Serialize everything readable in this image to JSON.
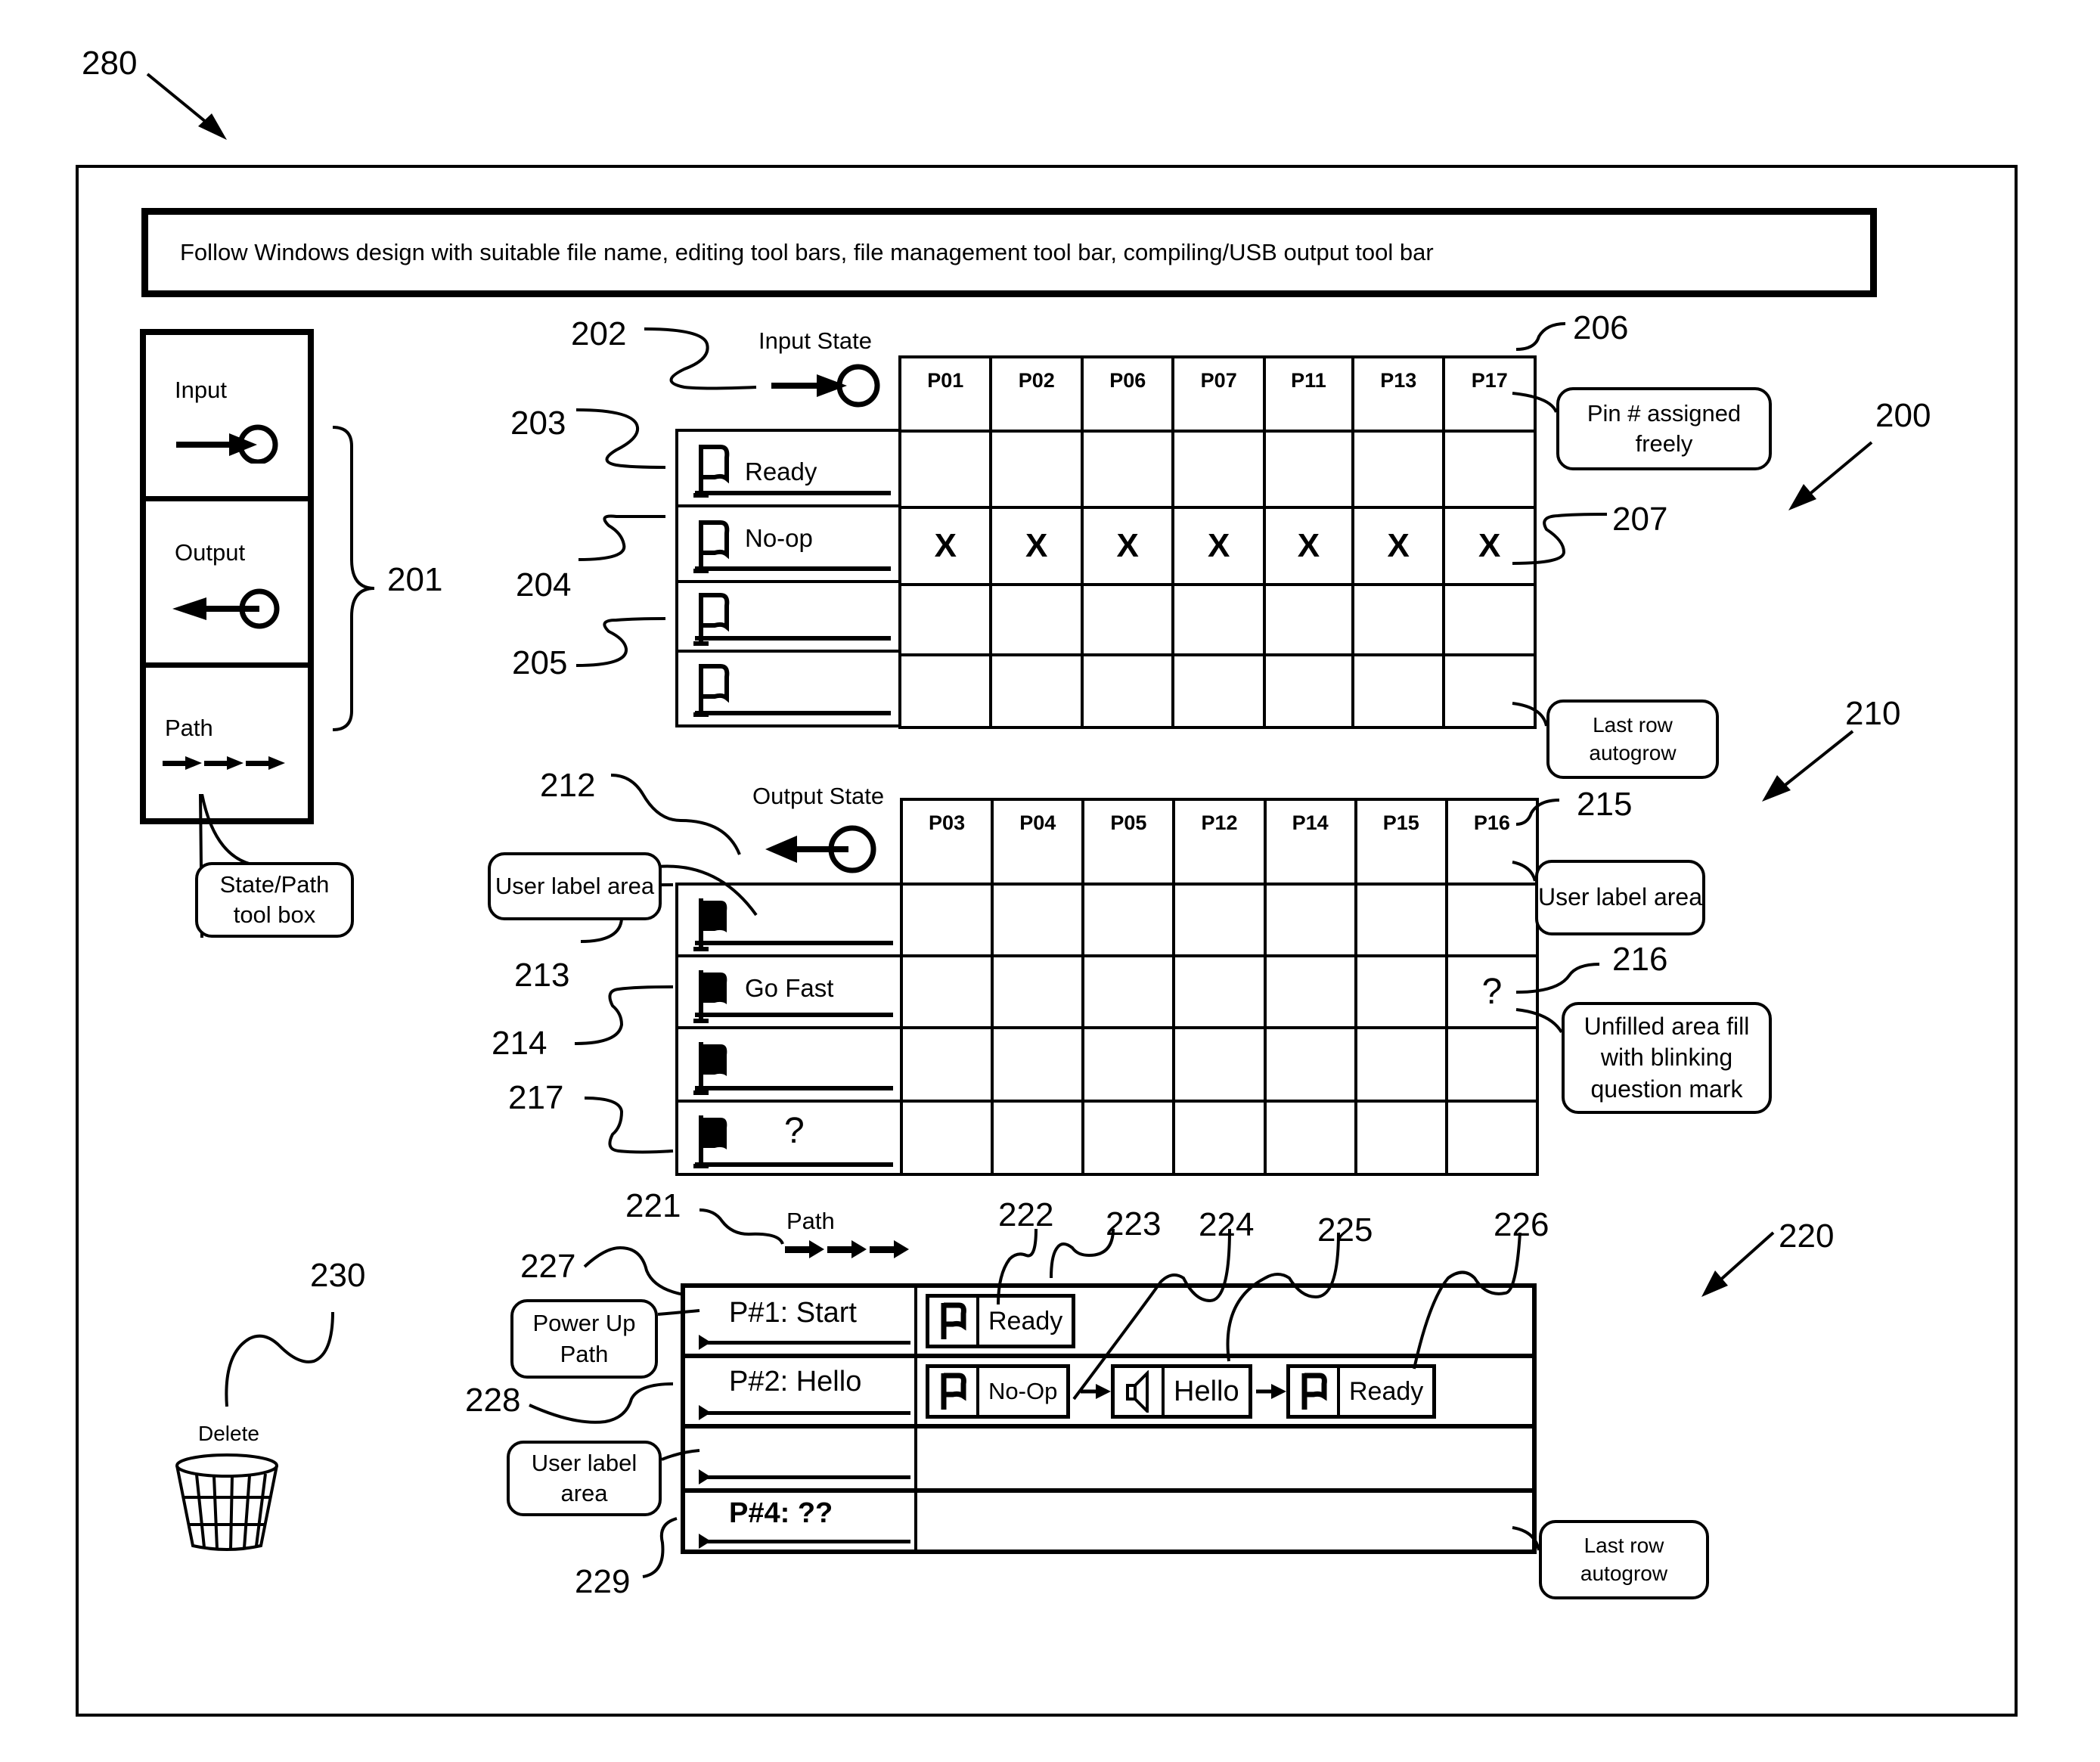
{
  "figure_refs": {
    "r280": "280",
    "r200": "200",
    "r201": "201",
    "r202": "202",
    "r203": "203",
    "r204": "204",
    "r205": "205",
    "r206": "206",
    "r207": "207",
    "r210": "210",
    "r212": "212",
    "r213": "213",
    "r214": "214",
    "r215": "215",
    "r216": "216",
    "r217": "217",
    "r220": "220",
    "r221": "221",
    "r222": "222",
    "r223": "223",
    "r224": "224",
    "r225": "225",
    "r226": "226",
    "r227": "227",
    "r228": "228",
    "r229": "229",
    "r230": "230"
  },
  "header_bar": {
    "text": "Follow Windows design with suitable file name, editing tool bars, file management tool bar, compiling/USB output tool bar"
  },
  "toolbox": {
    "items": [
      {
        "label": "Input",
        "icon": "input-arrow-circle-icon"
      },
      {
        "label": "Output",
        "icon": "output-arrow-circle-icon"
      },
      {
        "label": "Path",
        "icon": "path-arrows-icon"
      }
    ],
    "callout": "State/Path tool box"
  },
  "input_state": {
    "title": "Input State",
    "pins": [
      "P01",
      "P02",
      "P06",
      "P07",
      "P11",
      "P13",
      "P17"
    ],
    "rows": [
      {
        "label": "Ready",
        "cells": [
          "",
          "",
          "",
          "",
          "",
          "",
          ""
        ]
      },
      {
        "label": "No-op",
        "cells": [
          "X",
          "X",
          "X",
          "X",
          "X",
          "X",
          "X"
        ]
      },
      {
        "label": "",
        "cells": [
          "",
          "",
          "",
          "",
          "",
          "",
          ""
        ]
      },
      {
        "label": "",
        "cells": [
          "",
          "",
          "",
          "",
          "",
          "",
          ""
        ]
      }
    ],
    "callouts": {
      "pin_assigned": "Pin # assigned freely",
      "last_row": "Last row autogrow"
    }
  },
  "output_state": {
    "title": "Output State",
    "pins": [
      "P03",
      "P04",
      "P05",
      "P12",
      "P14",
      "P15",
      "P16"
    ],
    "rows": [
      {
        "label": "",
        "cells": [
          "",
          "",
          "",
          "",
          "",
          "",
          ""
        ]
      },
      {
        "label": "Go Fast",
        "cells": [
          "",
          "",
          "",
          "",
          "",
          "",
          "?"
        ]
      },
      {
        "label": "",
        "cells": [
          "",
          "",
          "",
          "",
          "",
          "",
          ""
        ]
      },
      {
        "label": "?",
        "cells": [
          "",
          "",
          "",
          "",
          "",
          "",
          ""
        ]
      }
    ],
    "callouts": {
      "user_label_left": "User label area",
      "user_label_right": "User label area",
      "unfilled": "Unfilled area fill with blinking question mark"
    }
  },
  "paths": {
    "title": "Path",
    "rows": [
      {
        "name": "P#1: Start",
        "bold": false,
        "steps": [
          {
            "icon": "flag-icon",
            "label": "Ready"
          }
        ]
      },
      {
        "name": "P#2: Hello",
        "bold": false,
        "steps": [
          {
            "icon": "flag-icon",
            "label": "No-Op"
          },
          {
            "icon": "speaker-icon",
            "label": "Hello"
          },
          {
            "icon": "flag-icon",
            "label": "Ready"
          }
        ]
      },
      {
        "name": "",
        "bold": false,
        "steps": []
      },
      {
        "name": "P#4: ??",
        "bold": true,
        "steps": []
      }
    ],
    "callouts": {
      "power_up": "Power Up Path",
      "user_label": "User label area",
      "last_row": "Last row autogrow"
    }
  },
  "delete": {
    "label": "Delete",
    "icon": "trash-bin-icon"
  }
}
